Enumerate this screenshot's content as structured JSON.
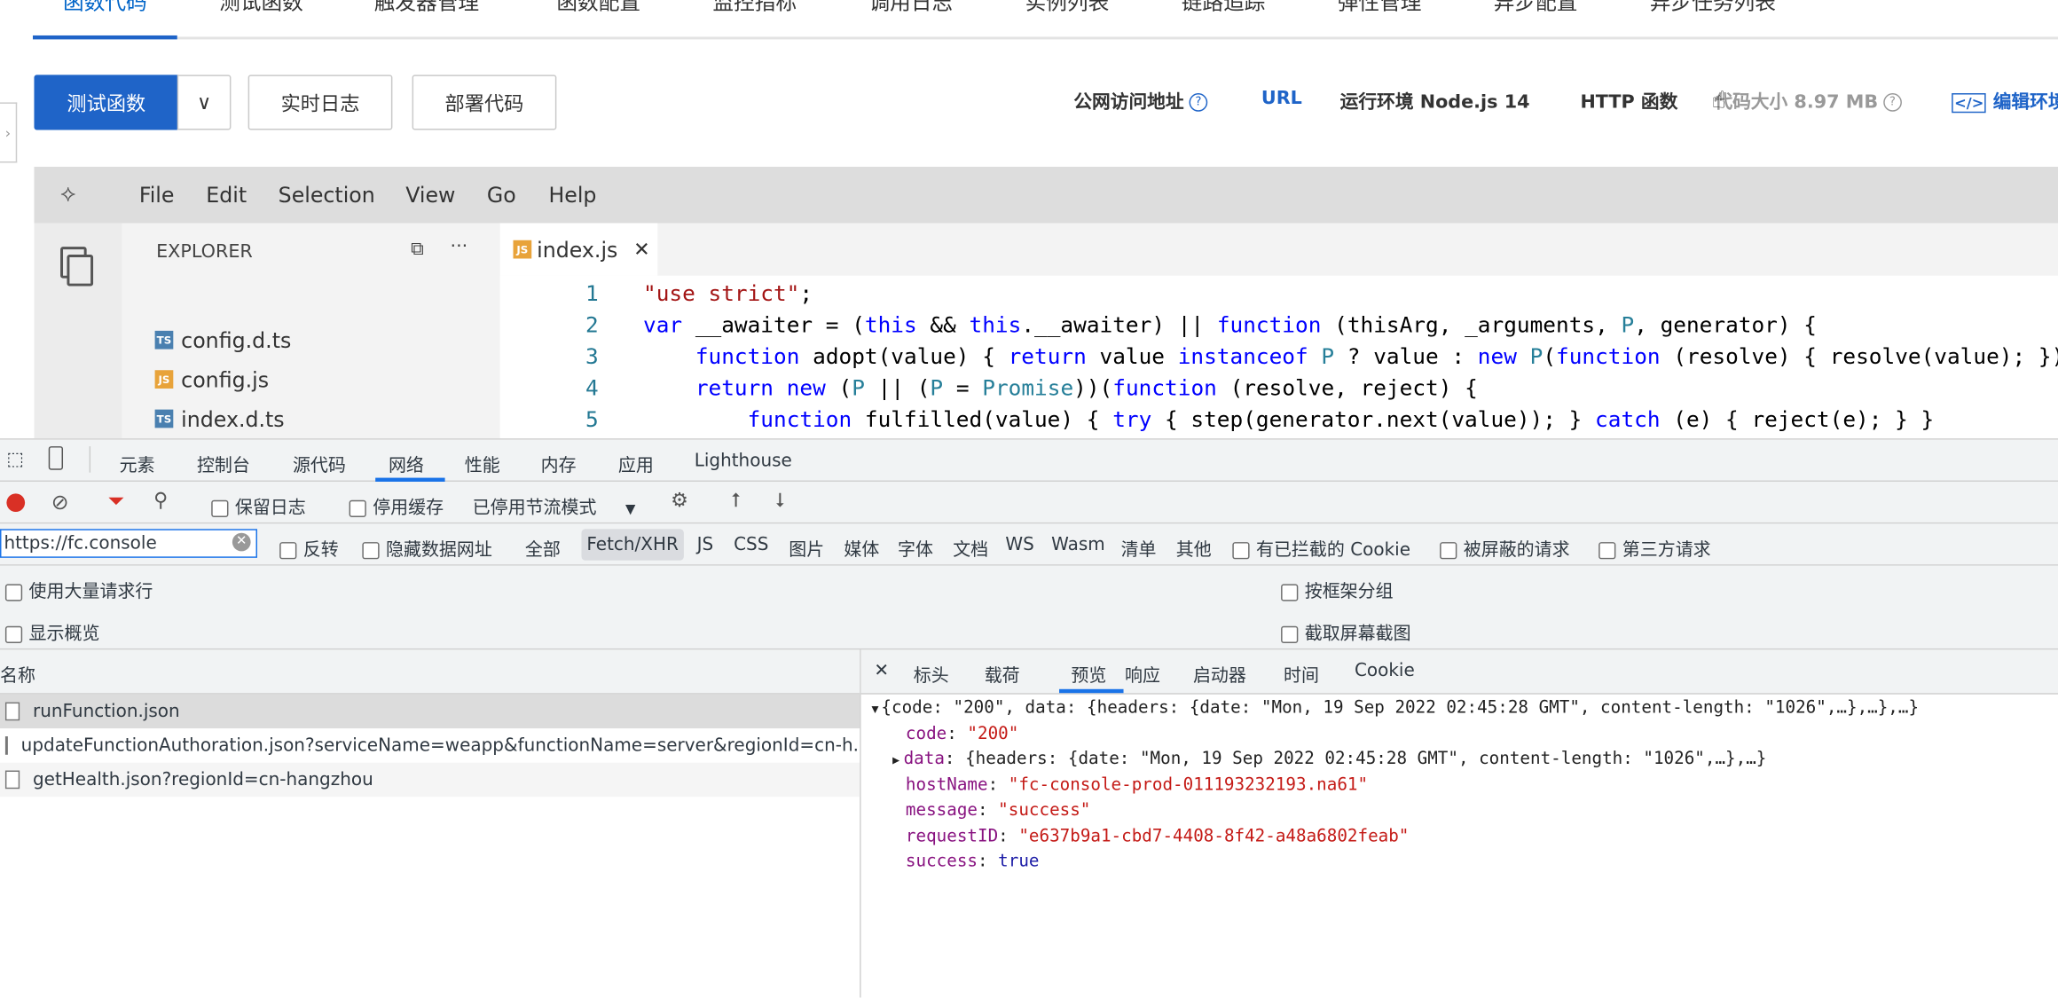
{
  "top_tabs": [
    "函数代码",
    "测试函数",
    "触发器管理",
    "函数配置",
    "监控指标",
    "调用日志",
    "实例列表",
    "链路追踪",
    "弹性管理",
    "异步配置",
    "异步任务列表"
  ],
  "actions": {
    "test": "测试函数",
    "logs": "实时日志",
    "deploy": "部署代码"
  },
  "info": {
    "public_url_label": "公网访问地址",
    "url": "URL",
    "runtime": "运行环境 Node.js 14",
    "type": "HTTP 函数",
    "code_size": "代码大小 8.97 MB",
    "edit_env": "编辑环境"
  },
  "ide": {
    "menu": [
      "File",
      "Edit",
      "Selection",
      "View",
      "Go",
      "Help"
    ],
    "explorer_title": "EXPLORER",
    "files": [
      {
        "name": "config.d.ts",
        "type": "TS"
      },
      {
        "name": "config.js",
        "type": "JS"
      },
      {
        "name": "index.d.ts",
        "type": "TS"
      },
      {
        "name": "index.js",
        "type": "JS",
        "selected": true
      }
    ],
    "open_tab": "index.js",
    "code": [
      [
        [
          "\"use strict\"",
          "s"
        ],
        [
          ";",
          "p"
        ]
      ],
      [
        [
          "var",
          "k"
        ],
        [
          " __awaiter = (",
          "p"
        ],
        [
          "this",
          "k"
        ],
        [
          " && ",
          "p"
        ],
        [
          "this",
          "k"
        ],
        [
          ".__awaiter) || ",
          "p"
        ],
        [
          "function",
          "k"
        ],
        [
          " (thisArg, _arguments, ",
          "p"
        ],
        [
          "P",
          "t"
        ],
        [
          ", generator) {",
          "p"
        ]
      ],
      [
        [
          "    ",
          "p"
        ],
        [
          "function",
          "k"
        ],
        [
          " adopt(value) { ",
          "p"
        ],
        [
          "return",
          "k"
        ],
        [
          " value ",
          "p"
        ],
        [
          "instanceof",
          "k"
        ],
        [
          " ",
          "p"
        ],
        [
          "P",
          "t"
        ],
        [
          " ? value : ",
          "p"
        ],
        [
          "new",
          "k"
        ],
        [
          " ",
          "p"
        ],
        [
          "P",
          "t"
        ],
        [
          "(",
          "p"
        ],
        [
          "function",
          "k"
        ],
        [
          " (resolve) { resolve(value); });",
          "p"
        ]
      ],
      [
        [
          "    ",
          "p"
        ],
        [
          "return",
          "k"
        ],
        [
          " ",
          "p"
        ],
        [
          "new",
          "k"
        ],
        [
          " (",
          "p"
        ],
        [
          "P",
          "t"
        ],
        [
          " || (",
          "p"
        ],
        [
          "P",
          "t"
        ],
        [
          " = ",
          "p"
        ],
        [
          "Promise",
          "t"
        ],
        [
          "))(",
          "p"
        ],
        [
          "function",
          "k"
        ],
        [
          " (resolve, reject) {",
          "p"
        ]
      ],
      [
        [
          "        ",
          "p"
        ],
        [
          "function",
          "k"
        ],
        [
          " fulfilled(value) { ",
          "p"
        ],
        [
          "try",
          "k"
        ],
        [
          " { step(generator.next(value)); } ",
          "p"
        ],
        [
          "catch",
          "k"
        ],
        [
          " (e) { reject(e); } }",
          "p"
        ]
      ]
    ]
  },
  "devtools": {
    "tabs": [
      "元素",
      "控制台",
      "源代码",
      "网络",
      "性能",
      "内存",
      "应用",
      "Lighthouse"
    ],
    "active_tab": "网络",
    "toolbar": {
      "preserve_log": "保留日志",
      "disable_cache": "停用缓存",
      "throttle": "已停用节流模式"
    },
    "filter": {
      "value": "https://fc.console",
      "invert": "反转",
      "hide_data_urls": "隐藏数据网址",
      "types": [
        "全部",
        "Fetch/XHR",
        "JS",
        "CSS",
        "图片",
        "媒体",
        "字体",
        "文档",
        "WS",
        "Wasm",
        "清单",
        "其他"
      ],
      "active_type": "Fetch/XHR",
      "blocked_cookies": "有已拦截的 Cookie",
      "blocked_requests": "被屏蔽的请求",
      "third_party": "第三方请求"
    },
    "options": {
      "large_rows": "使用大量请求行",
      "group_by_frame": "按框架分组",
      "show_overview": "显示概览",
      "capture_screenshots": "截取屏幕截图"
    },
    "requests_header": "名称",
    "requests": [
      "runFunction.json",
      "updateFunctionAuthoration.json?serviceName=weapp&functionName=server&regionId=cn-h...",
      "getHealth.json?regionId=cn-hangzhou"
    ],
    "detail_tabs": [
      "标头",
      "载荷",
      "预览",
      "响应",
      "启动器",
      "时间",
      "Cookie"
    ],
    "active_detail_tab": "预览",
    "preview": {
      "summary": "{code: \"200\", data: {headers: {date: \"Mon, 19 Sep 2022 02:45:28 GMT\", content-length: \"1026\",…},…},…}",
      "fields": [
        {
          "key": "code",
          "value": "\"200\"",
          "kind": "string"
        },
        {
          "key": "data",
          "value": "{headers: {date: \"Mon, 19 Sep 2022 02:45:28 GMT\", content-length: \"1026\",…},…}",
          "kind": "object"
        },
        {
          "key": "hostName",
          "value": "\"fc-console-prod-011193232193.na61\"",
          "kind": "string"
        },
        {
          "key": "message",
          "value": "\"success\"",
          "kind": "string"
        },
        {
          "key": "requestID",
          "value": "\"e637b9a1-cbd7-4408-8f42-a48a6802feab\"",
          "kind": "string"
        },
        {
          "key": "success",
          "value": "true",
          "kind": "bool"
        }
      ]
    }
  },
  "colors": {
    "accent": "#1f64c8",
    "record": "#d93025",
    "filter": "#d93025"
  }
}
